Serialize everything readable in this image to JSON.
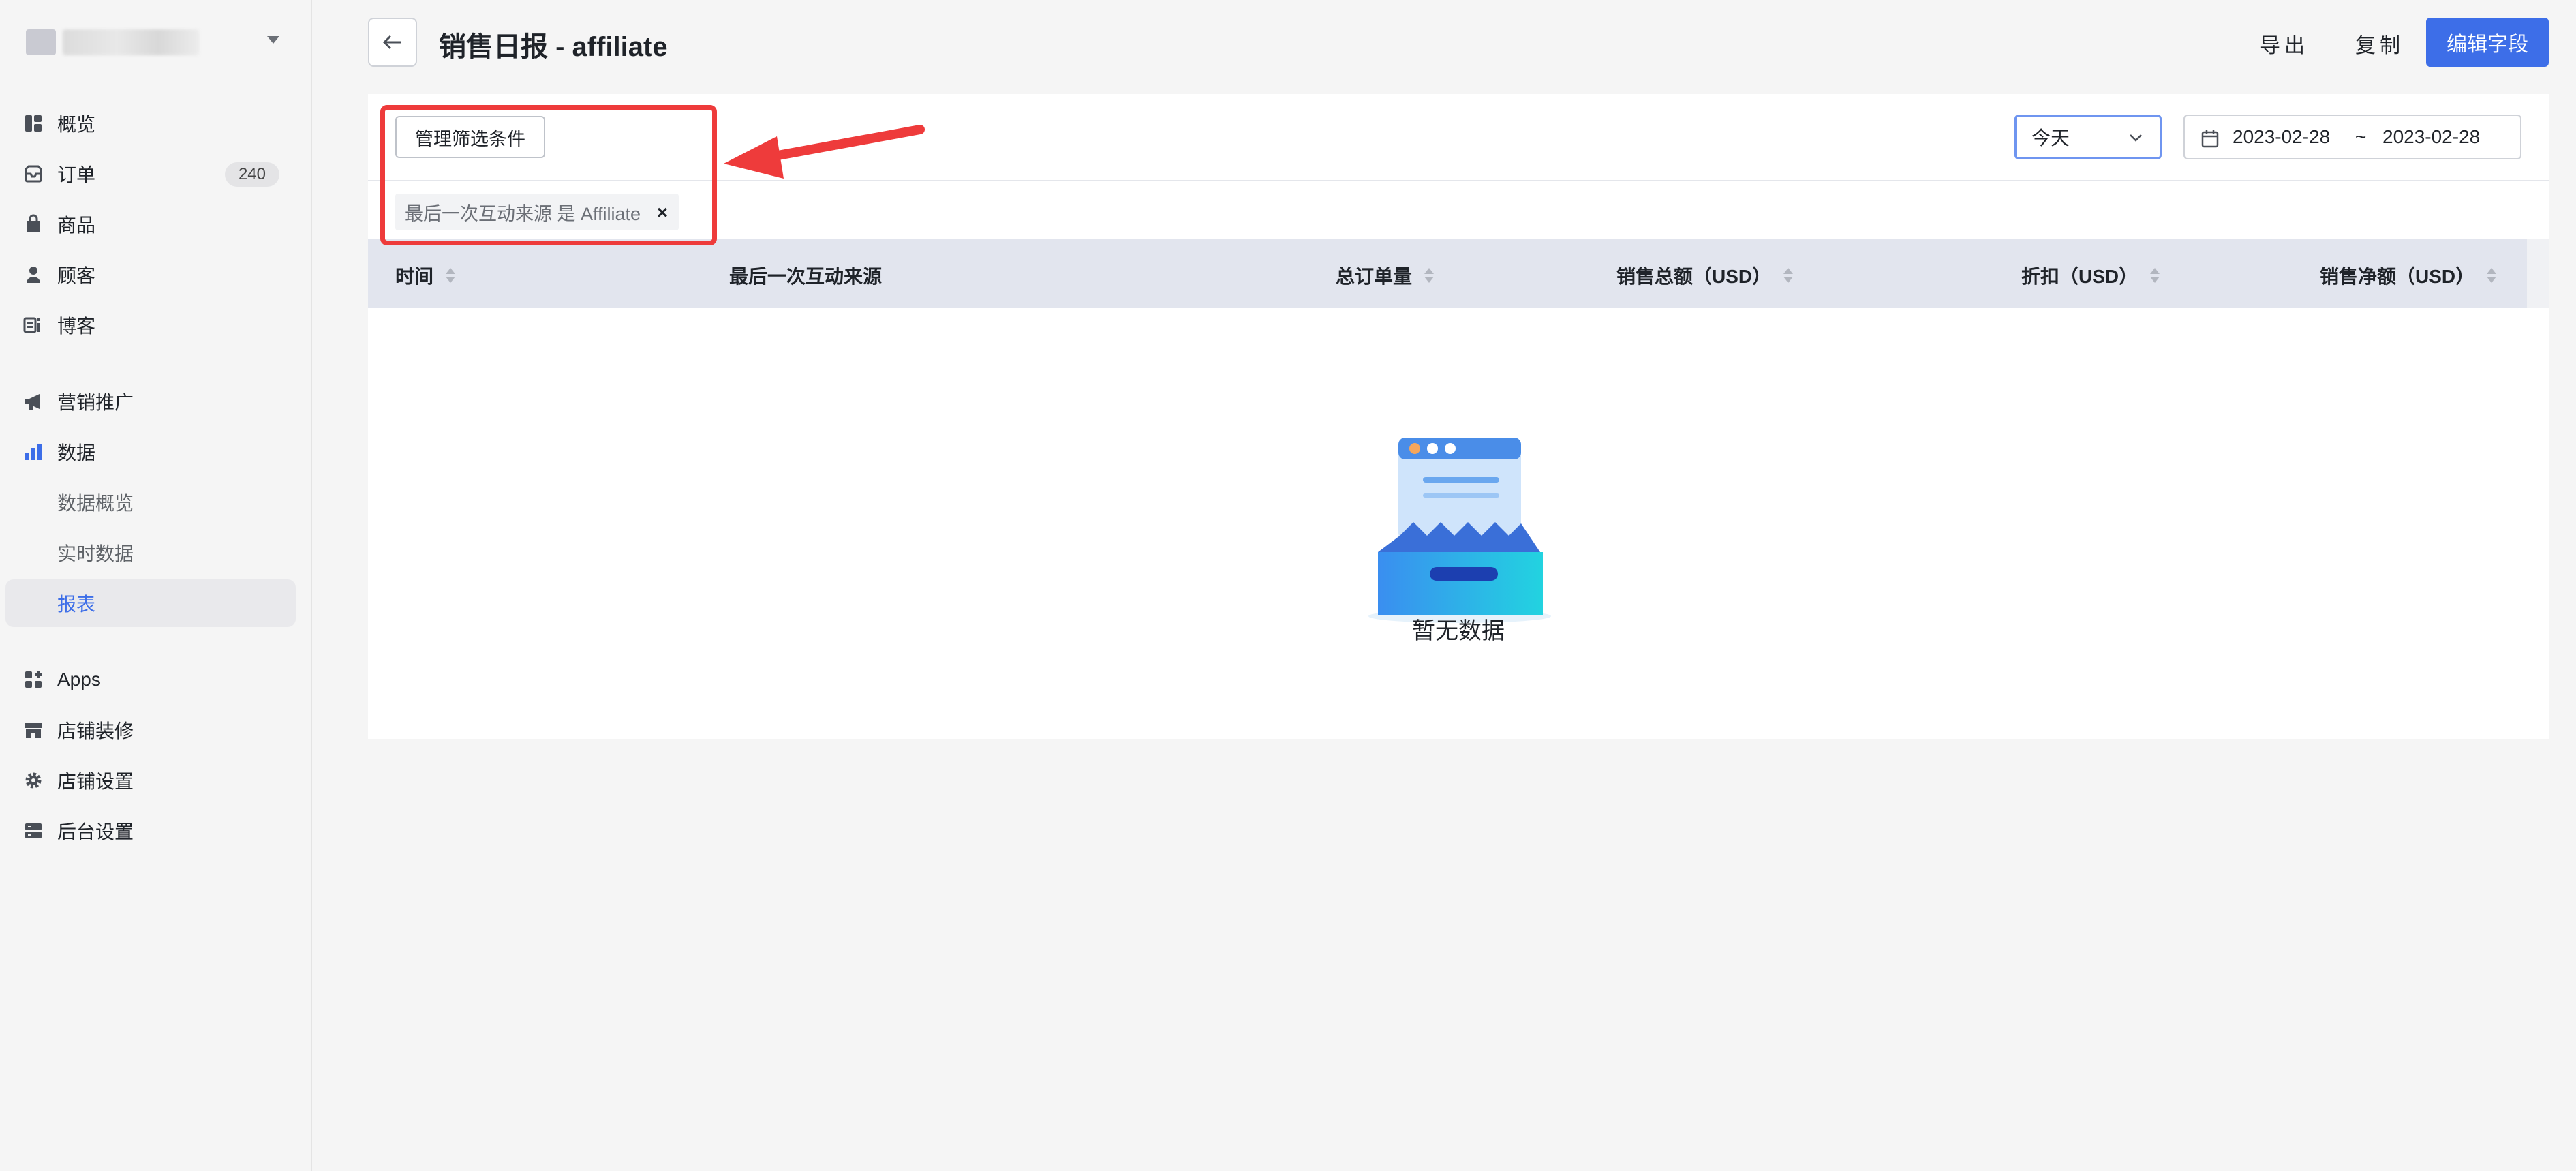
{
  "sidebar": {
    "store_name": "",
    "items": [
      {
        "key": "overview",
        "label": "概览",
        "icon": "dashboard-icon"
      },
      {
        "key": "orders",
        "label": "订单",
        "icon": "inbox-icon",
        "badge": "240"
      },
      {
        "key": "products",
        "label": "商品",
        "icon": "shopping-bag-icon"
      },
      {
        "key": "customers",
        "label": "顾客",
        "icon": "person-icon"
      },
      {
        "key": "blog",
        "label": "博客",
        "icon": "blog-icon"
      },
      {
        "key": "marketing",
        "label": "营销推广",
        "icon": "megaphone-icon"
      },
      {
        "key": "data",
        "label": "数据",
        "icon": "bar-chart-icon"
      },
      {
        "key": "data-overview",
        "label": "数据概览"
      },
      {
        "key": "realtime",
        "label": "实时数据"
      },
      {
        "key": "reports",
        "label": "报表",
        "active": true
      },
      {
        "key": "apps",
        "label": "Apps",
        "icon": "apps-icon"
      },
      {
        "key": "store-decor",
        "label": "店铺装修",
        "icon": "storefront-icon"
      },
      {
        "key": "store-settings",
        "label": "店铺设置",
        "icon": "gear-icon"
      },
      {
        "key": "admin-settings",
        "label": "后台设置",
        "icon": "server-icon"
      }
    ]
  },
  "header": {
    "title": "销售日报 - affiliate",
    "export_label": "导出",
    "copy_label": "复制",
    "edit_fields_label": "编辑字段"
  },
  "filters": {
    "manage_label": "管理筛选条件",
    "period_selected": "今天",
    "date_start": "2023-02-28",
    "date_separator": "~",
    "date_end": "2023-02-28",
    "tag_label": "最后一次互动来源 是 Affiliate",
    "tag_close": "×"
  },
  "table": {
    "columns": [
      {
        "label": "时间",
        "sortable": true
      },
      {
        "label": "最后一次互动来源",
        "sortable": false
      },
      {
        "label": "总订单量",
        "sortable": true
      },
      {
        "label": "销售总额（USD）",
        "sortable": true
      },
      {
        "label": "折扣（USD）",
        "sortable": true
      },
      {
        "label": "销售净额（USD）",
        "sortable": true
      }
    ],
    "rows": [],
    "empty_text": "暂无数据"
  },
  "colors": {
    "accent": "#3d6ee8",
    "annotation": "#ee3b3b",
    "table_header_bg": "#e2e5ee"
  }
}
